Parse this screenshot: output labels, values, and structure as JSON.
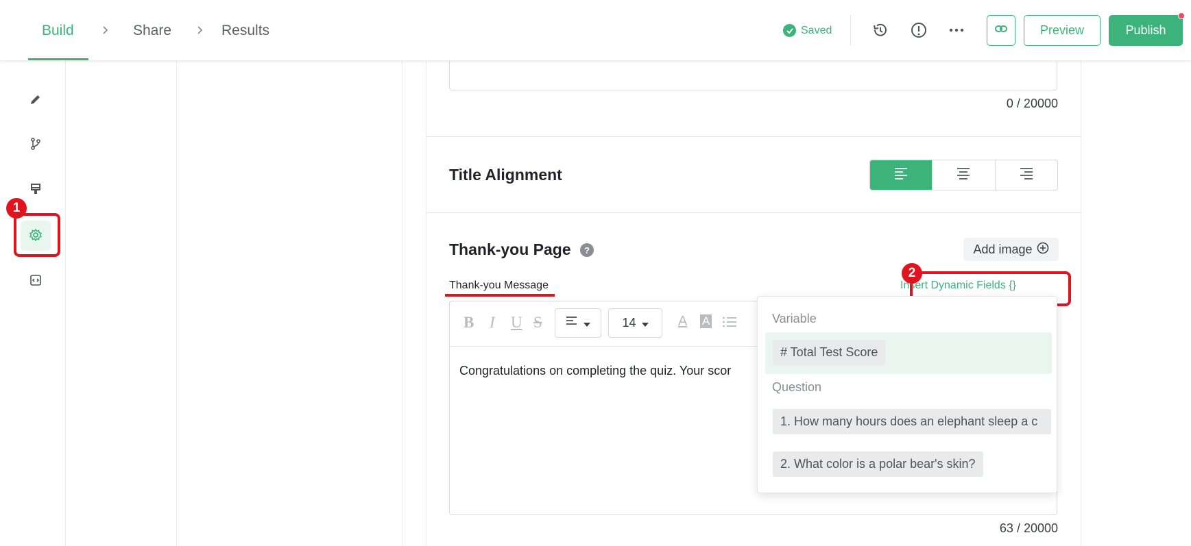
{
  "nav": {
    "steps": [
      "Build",
      "Share",
      "Results"
    ],
    "saved_label": "Saved",
    "preview_label": "Preview",
    "publish_label": "Publish",
    "icons": [
      "history-icon",
      "info-icon",
      "more-icon",
      "link-icon"
    ]
  },
  "sidebar": {
    "icons": [
      "pencil-icon",
      "branch-icon",
      "paint-icon",
      "settings-icon",
      "embed-code-icon"
    ],
    "active": "settings-icon",
    "annotation_1": "1"
  },
  "settings": {
    "top_counter": "0 / 20000",
    "title_alignment": {
      "label": "Title Alignment",
      "options": [
        "left",
        "center",
        "right"
      ],
      "selected": "left"
    },
    "thank_you": {
      "title": "Thank-you Page",
      "add_image_label": "Add image",
      "message_label": "Thank-you Message",
      "insert_dynamic_label": "Insert Dynamic Fields {}",
      "annotation_2": "2",
      "toolbar": {
        "bold": "B",
        "italic": "I",
        "underline": "U",
        "strike": "S",
        "font_size": "14",
        "font_color": "A",
        "bg_color": "A"
      },
      "editor_text": "Congratulations on completing the quiz. Your scor",
      "counter": "63 / 20000"
    }
  },
  "dynamic_fields": {
    "variable_header": "Variable",
    "variables": [
      "# Total Test Score"
    ],
    "question_header": "Question",
    "questions": [
      "1. How many hours does an elephant sleep a c",
      "2. What color is a polar bear's skin?"
    ]
  },
  "colors": {
    "accent": "#3cb37a",
    "annotation": "#e0141e"
  }
}
